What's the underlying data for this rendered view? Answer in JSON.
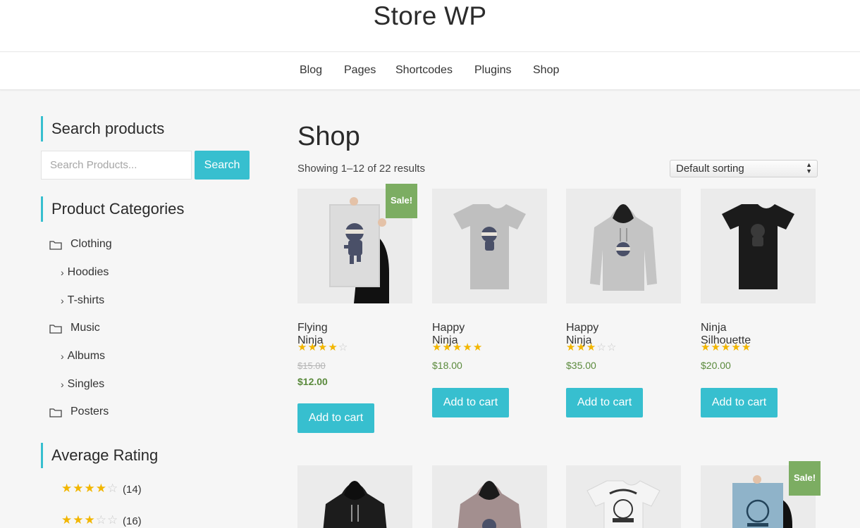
{
  "header": {
    "site_title": "Store WP"
  },
  "nav": {
    "items": [
      "Blog",
      "Pages",
      "Shortcodes",
      "Plugins",
      "Shop"
    ]
  },
  "sidebar": {
    "search": {
      "title": "Search products",
      "placeholder": "Search Products...",
      "button_label": "Search"
    },
    "categories": {
      "title": "Product Categories",
      "items": [
        {
          "label": "Clothing",
          "level": 0,
          "icon": "folder-icon"
        },
        {
          "label": "Hoodies",
          "level": 1,
          "icon": "chevron-right-icon"
        },
        {
          "label": "T-shirts",
          "level": 1,
          "icon": "chevron-right-icon"
        },
        {
          "label": "Music",
          "level": 0,
          "icon": "folder-icon"
        },
        {
          "label": "Albums",
          "level": 1,
          "icon": "chevron-right-icon"
        },
        {
          "label": "Singles",
          "level": 1,
          "icon": "chevron-right-icon"
        },
        {
          "label": "Posters",
          "level": 0,
          "icon": "folder-icon"
        }
      ]
    },
    "rating": {
      "title": "Average Rating",
      "items": [
        {
          "stars": 4,
          "count": "(14)"
        },
        {
          "stars": 3,
          "count": "(16)"
        }
      ]
    }
  },
  "shop": {
    "title": "Shop",
    "result_count": "Showing 1–12 of 22 results",
    "sorting": {
      "selected": "Default sorting"
    },
    "add_to_cart_label": "Add to cart",
    "sale_label": "Sale!",
    "products": [
      {
        "name": "Flying Ninja",
        "rating": 4,
        "old_price": "$15.00",
        "price": "$12.00",
        "sale": true,
        "image": "poster-ninja"
      },
      {
        "name": "Happy Ninja",
        "rating": 5,
        "old_price": "",
        "price": "$18.00",
        "sale": false,
        "image": "tshirt-grey"
      },
      {
        "name": "Happy Ninja",
        "rating": 3,
        "old_price": "",
        "price": "$35.00",
        "sale": false,
        "image": "hoodie-grey"
      },
      {
        "name": "Ninja Silhouette",
        "rating": 5,
        "old_price": "",
        "price": "$20.00",
        "sale": false,
        "image": "tshirt-black"
      }
    ],
    "second_row": [
      {
        "image": "hoodie-black",
        "sale": false
      },
      {
        "image": "hoodie-pink",
        "sale": false
      },
      {
        "image": "tshirt-white",
        "sale": false
      },
      {
        "image": "poster-woo",
        "sale": true
      }
    ]
  },
  "colors": {
    "accent": "#37bfcf",
    "sale": "#7cad62",
    "price": "#5a8a3c",
    "star": "#f2b600"
  }
}
